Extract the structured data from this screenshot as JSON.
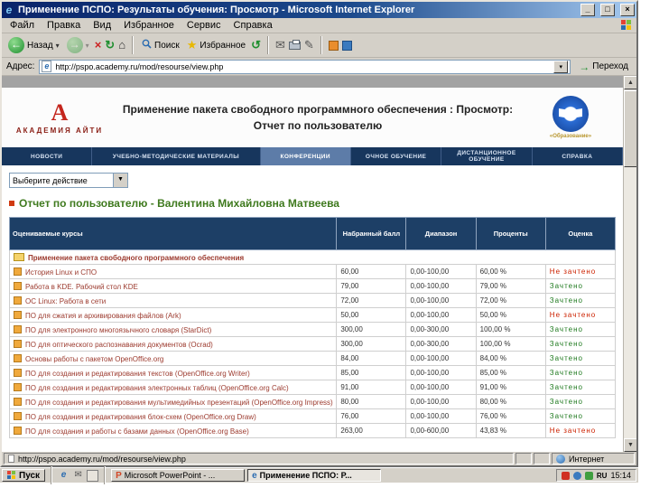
{
  "window": {
    "title": "Применение ПСПО: Результаты обучения: Просмотр - Microsoft Internet Explorer",
    "controls": {
      "minimize": "_",
      "maximize": "□",
      "close": "×"
    }
  },
  "menu": {
    "items": [
      "Файл",
      "Правка",
      "Вид",
      "Избранное",
      "Сервис",
      "Справка"
    ]
  },
  "toolbar": {
    "back": "Назад",
    "search": "Поиск",
    "favorites": "Избранное"
  },
  "address": {
    "label": "Адрес:",
    "value": "http://pspo.academy.ru/mod/resourse/view.php",
    "go": "Переход"
  },
  "header": {
    "logo_left": "АКАДЕМИЯ АЙТИ",
    "title_line1": "Применение пакета свободного программного обеспечения : Просмотр:",
    "title_line2": "Отчет по пользователю",
    "logo_right": "«Образование»"
  },
  "nav": {
    "tabs": [
      {
        "label": "НОВОСТИ",
        "active": false
      },
      {
        "label": "УЧЕБНО-МЕТОДИЧЕСКИЕ МАТЕРИАЛЫ",
        "active": false
      },
      {
        "label": "КОНФЕРЕНЦИИ",
        "active": true
      },
      {
        "label": "ОЧНОЕ ОБУЧЕНИЕ",
        "active": false
      },
      {
        "label": "ДИСТАНЦИОННОЕ ОБУЧЕНИЕ",
        "active": false
      },
      {
        "label": "СПРАВКА",
        "active": false
      }
    ]
  },
  "actions": {
    "select_value": "Выберите действие"
  },
  "report": {
    "title": "Отчет по пользователю - Валентина Михайловна Матвеева"
  },
  "table": {
    "headers": [
      "Оцениваемые курсы",
      "Набранный балл",
      "Диапазон",
      "Проценты",
      "Оценка"
    ],
    "group_row": "Применение пакета свободного программного обеспечения",
    "rows": [
      {
        "name": "История Linux и СПО",
        "score": "60,00",
        "range": "0,00-100,00",
        "percent": "60,00 %",
        "grade": "Не зачтено",
        "status": "fail"
      },
      {
        "name": "Работа в KDE. Рабочий стол KDE",
        "score": "79,00",
        "range": "0,00-100,00",
        "percent": "79,00 %",
        "grade": "Зачтено",
        "status": "pass"
      },
      {
        "name": "ОС Linux: Работа в сети",
        "score": "72,00",
        "range": "0,00-100,00",
        "percent": "72,00 %",
        "grade": "Зачтено",
        "status": "pass"
      },
      {
        "name": "ПО для сжатия и архивирования файлов (Ark)",
        "score": "50,00",
        "range": "0,00-100,00",
        "percent": "50,00 %",
        "grade": "Не зачтено",
        "status": "fail"
      },
      {
        "name": "ПО для электронного многоязычного словаря (StarDict)",
        "score": "300,00",
        "range": "0,00-300,00",
        "percent": "100,00 %",
        "grade": "Зачтено",
        "status": "pass"
      },
      {
        "name": "ПО для оптического распознавания документов (Ocrad)",
        "score": "300,00",
        "range": "0,00-300,00",
        "percent": "100,00 %",
        "grade": "Зачтено",
        "status": "pass"
      },
      {
        "name": "Основы работы с пакетом OpenOffice.org",
        "score": "84,00",
        "range": "0,00-100,00",
        "percent": "84,00 %",
        "grade": "Зачтено",
        "status": "pass"
      },
      {
        "name": "ПО для создания и редактирования текстов (OpenOffice.org Writer)",
        "score": "85,00",
        "range": "0,00-100,00",
        "percent": "85,00 %",
        "grade": "Зачтено",
        "status": "pass"
      },
      {
        "name": "ПО для создания и редактирования электронных таблиц (OpenOffice.org Calc)",
        "score": "91,00",
        "range": "0,00-100,00",
        "percent": "91,00 %",
        "grade": "Зачтено",
        "status": "pass"
      },
      {
        "name": "ПО для создания и редактирования мультимедийных презентаций (OpenOffice.org Impress)",
        "score": "80,00",
        "range": "0,00-100,00",
        "percent": "80,00 %",
        "grade": "Зачтено",
        "status": "pass"
      },
      {
        "name": "ПО для создания и редактирования блок-схем (OpenOffice.org Draw)",
        "score": "76,00",
        "range": "0,00-100,00",
        "percent": "76,00 %",
        "grade": "Зачтено",
        "status": "pass"
      },
      {
        "name": "ПО для создания и работы с базами данных (OpenOffice.org Base)",
        "score": "263,00",
        "range": "0,00-600,00",
        "percent": "43,83 %",
        "grade": "Не зачтено",
        "status": "fail"
      }
    ]
  },
  "status_bar": {
    "left": "http://pspo.academy.ru/mod/resourse/view.php",
    "zone": "Интернет"
  },
  "taskbar": {
    "start": "Пуск",
    "tasks": [
      {
        "label": "Microsoft PowerPoint - ...",
        "icon": "powerpoint-icon",
        "active": false
      },
      {
        "label": "Применение ПСПО: Р...",
        "icon": "ie-icon",
        "active": true
      }
    ],
    "tray": {
      "lang": "RU",
      "time": "15:14",
      "icons": [
        "antivirus-icon",
        "network-icon",
        "volume-icon"
      ]
    }
  },
  "colors": {
    "titlebar_start": "#0a246a",
    "titlebar_end": "#a6caf0",
    "nav_bg": "#17365d",
    "nav_active": "#5d7ca8",
    "table_header_bg": "#1d3f66",
    "link": "#9c3a2e",
    "pass": "#1f7a1f",
    "fail": "#cc2200"
  }
}
